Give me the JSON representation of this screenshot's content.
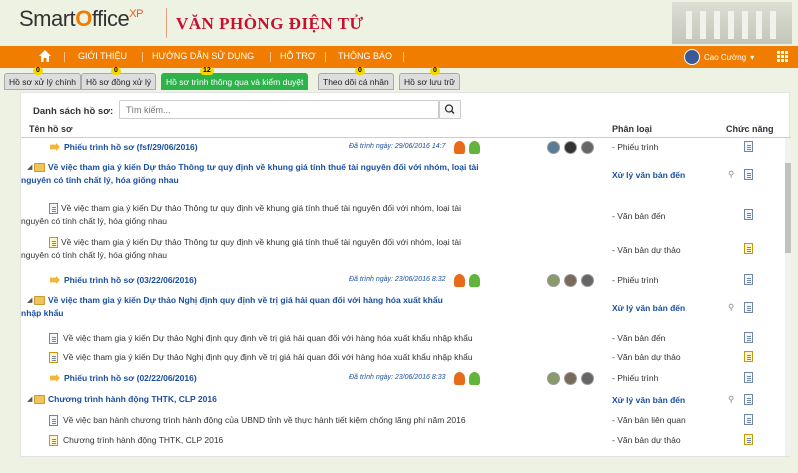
{
  "header": {
    "logo_text": "Smart",
    "logo_o": "O",
    "logo_rest": "ffice",
    "logo_sup": "XP",
    "brand": "VĂN PHÒNG ĐIỆN TỬ"
  },
  "nav": {
    "items": [
      "GIỚI THIỆU",
      "HƯỚNG DẪN SỬ DỤNG",
      "HỖ TRỢ",
      "THÔNG BÁO"
    ],
    "user": "Cao Cường",
    "accent": "#f07d00"
  },
  "tabs": [
    {
      "label": "Hồ sơ xử lý chính",
      "badge": "0"
    },
    {
      "label": "Hồ sơ đồng xử lý",
      "badge": "0"
    },
    {
      "label": "Hồ sơ trình thông qua và kiểm duyệt",
      "badge": "12",
      "active": true
    },
    {
      "label": "Theo dõi cá nhân",
      "badge": "0"
    },
    {
      "label": "Hồ sơ lưu trữ",
      "badge": "0"
    }
  ],
  "search": {
    "label": "Danh sách hồ sơ:",
    "placeholder": "Tìm kiếm..."
  },
  "columns": {
    "name": "Tên hồ sơ",
    "category": "Phân loại",
    "action": "Chức năng"
  },
  "rows": [
    {
      "title": "Phiếu trình hồ sơ (fsf/29/06/2016)",
      "date": "Đã trình ngày: 29/06/2016 14:7",
      "category": "- Phiếu trình"
    },
    {
      "title": "Về việc tham gia ý kiến Dự thảo Thông tư quy định về khung giá tính thuế tài nguyên đối với nhóm, loại tài nguyên có tính chất lý, hóa giống nhau",
      "category": "Xử lý văn bản đến"
    },
    {
      "title": "Về việc tham gia ý kiến Dự thảo Thông tư quy định về khung giá tính thuế tài nguyên đối với nhóm, loại tài nguyên có tính chất lý, hóa giống nhau",
      "category": "- Văn bản đến"
    },
    {
      "title": "Về việc tham gia ý kiến Dự thảo Thông tư quy định về khung giá tính thuế tài nguyên đối với nhóm, loại tài nguyên có tính chất lý, hóa giống nhau",
      "category": "- Văn bản dự thảo"
    },
    {
      "title": "Phiếu trình hồ sơ (03/22/06/2016)",
      "date": "Đã trình ngày: 23/06/2016 8:32",
      "category": "- Phiếu trình"
    },
    {
      "title": "Về việc tham gia ý kiến Dự thảo Nghị định quy định về trị giá hải quan đối với hàng hóa xuất khẩu nhập khẩu",
      "category": "Xử lý văn bản đến"
    },
    {
      "title": "Về việc tham gia ý kiến Dự thảo Nghị định quy định về trị giá hải quan đối với hàng hóa xuất khẩu nhập khẩu",
      "category": "- Văn bản đến"
    },
    {
      "title": "Về việc tham gia ý kiến Dự thảo Nghị định quy định về trị giá hải quan đối với hàng hóa xuất khẩu nhập khẩu",
      "category": "- Văn bản dự thảo"
    },
    {
      "title": "Phiếu trình hồ sơ (02/22/06/2016)",
      "date": "Đã trình ngày: 23/06/2016 8:33",
      "category": "- Phiếu trình"
    },
    {
      "title": "Chương trình hành động THTK, CLP 2016",
      "category": "Xử lý văn bản đến"
    },
    {
      "title": "Về việc ban hành chương trình hành động của UBND tỉnh về thực hành tiết kiệm chống lãng phí năm 2016",
      "category": "- Văn bản liên quan"
    },
    {
      "title": "Chương trình hành động THTK, CLP 2016",
      "category": "- Văn bản dự thảo"
    }
  ]
}
